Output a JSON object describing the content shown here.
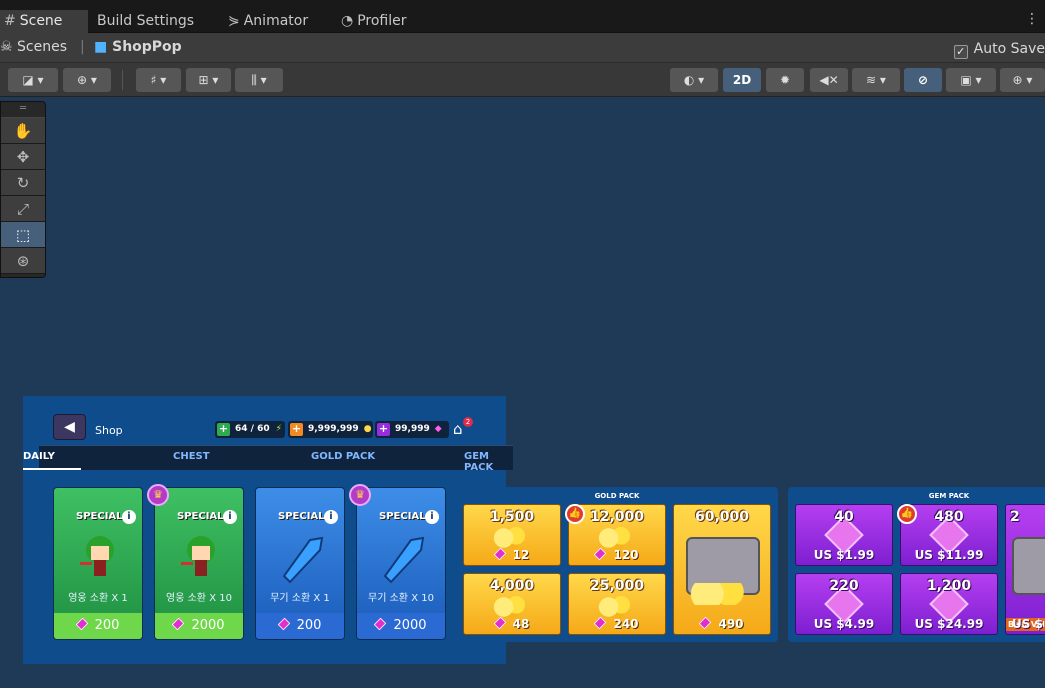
{
  "editor_tabs": [
    {
      "label": "Scene",
      "icon": "grid-icon"
    },
    {
      "label": "Build Settings",
      "icon": ""
    },
    {
      "label": "Animator",
      "icon": "animator-icon"
    },
    {
      "label": "Profiler",
      "icon": "profiler-icon"
    }
  ],
  "breadcrumb": {
    "root": "Scenes",
    "current": "ShopPop"
  },
  "auto_save": {
    "label": "Auto Save",
    "checked": true
  },
  "toolbar": {
    "mode_2d": "2D"
  },
  "shop": {
    "title": "Shop",
    "energy": "64 / 60",
    "gold": "9,999,999",
    "gems": "99,999",
    "notification_count": "2",
    "tabs": [
      "DAILY",
      "CHEST",
      "GOLD PACK",
      "GEM PACK"
    ],
    "active_tab": "DAILY",
    "daily_items": [
      {
        "tag": "SPECIAL",
        "caption": "영웅 소환 X 1",
        "price": "200",
        "style": "green",
        "crown": false
      },
      {
        "tag": "SPECIAL",
        "caption": "영웅 소환 X 10",
        "price": "2000",
        "style": "green",
        "crown": true
      },
      {
        "tag": "SPECIAL",
        "caption": "무기 소환 X 1",
        "price": "200",
        "style": "blue",
        "crown": false
      },
      {
        "tag": "SPECIAL",
        "caption": "무기 소환 X 10",
        "price": "2000",
        "style": "blue",
        "crown": true
      }
    ]
  },
  "gold_pack": {
    "title": "GOLD PACK",
    "items": [
      {
        "amount": "1,500",
        "price": "12"
      },
      {
        "amount": "12,000",
        "price": "120"
      },
      {
        "amount": "60,000",
        "price": "490"
      },
      {
        "amount": "4,000",
        "price": "48"
      },
      {
        "amount": "25,000",
        "price": "240"
      }
    ]
  },
  "gem_pack": {
    "title": "GEM PACK",
    "items": [
      {
        "amount": "40",
        "price": "US $1.99"
      },
      {
        "amount": "480",
        "price": "US $11.99"
      },
      {
        "amount": "220",
        "price": "US $4.99"
      },
      {
        "amount": "1,200",
        "price": "US $24.99"
      },
      {
        "amount": "2",
        "price": "US $",
        "badge": "Best Value"
      }
    ]
  },
  "colors": {
    "scene_bg": "#1f3a57",
    "shop_bg": "#0f4c8b",
    "green_card": "#3fc063",
    "blue_card": "#3d8ee8",
    "gold_tile": "#ffd84a",
    "gem_tile": "#b53ff0"
  }
}
